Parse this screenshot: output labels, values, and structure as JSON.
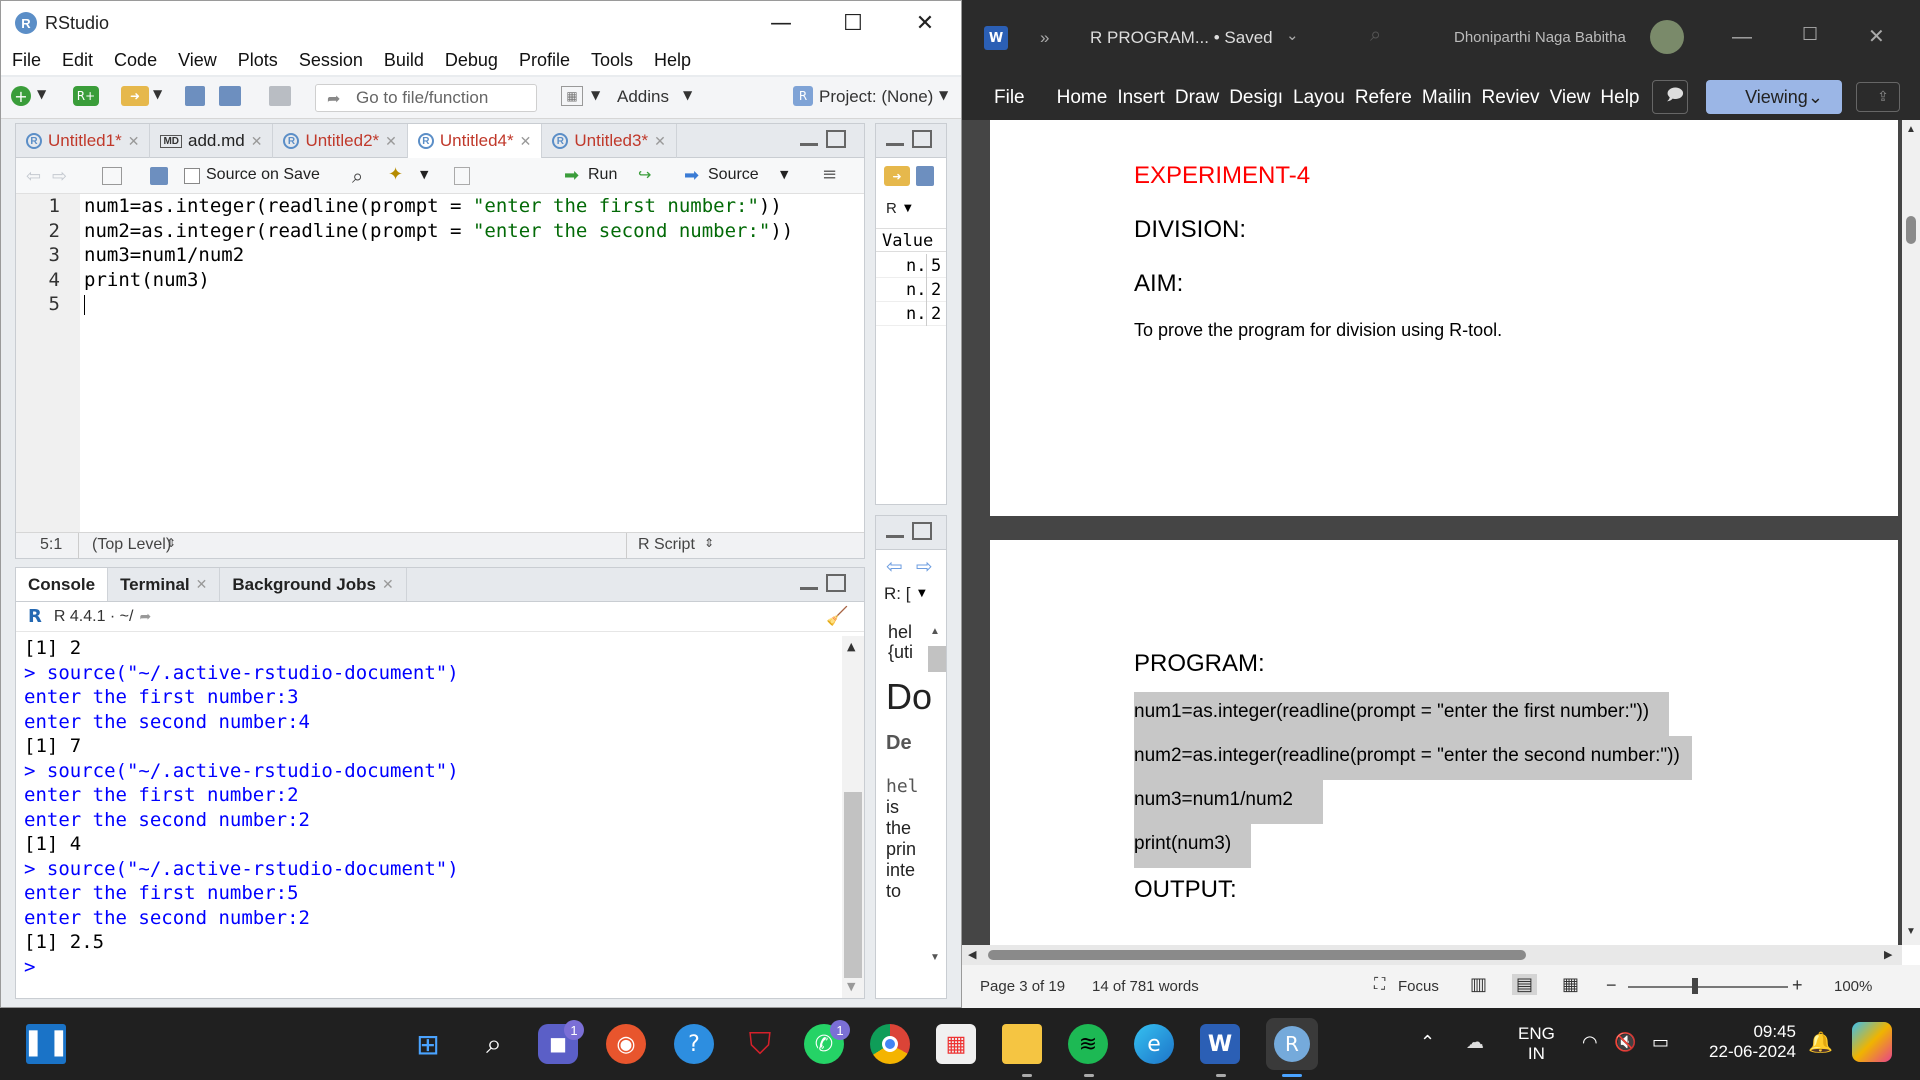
{
  "rstudio": {
    "title": "RStudio",
    "menu": [
      "File",
      "Edit",
      "Code",
      "View",
      "Plots",
      "Session",
      "Build",
      "Debug",
      "Profile",
      "Tools",
      "Help"
    ],
    "toolbar": {
      "goto_placeholder": "Go to file/function",
      "addins": "Addins",
      "project": "Project: (None)"
    },
    "editor": {
      "tabs": [
        {
          "label": "Untitled1*",
          "type": "r"
        },
        {
          "label": "add.md",
          "type": "md"
        },
        {
          "label": "Untitled2*",
          "type": "r"
        },
        {
          "label": "Untitled4*",
          "type": "r",
          "active": true
        },
        {
          "label": "Untitled3*",
          "type": "r"
        }
      ],
      "source_on_save": "Source on Save",
      "run": "Run",
      "source": "Source",
      "line_numbers": [
        "1",
        "2",
        "3",
        "4",
        "5"
      ],
      "lines": [
        {
          "pre": "num1=as.integer(readline(prompt = ",
          "str": "\"enter the first number:\"",
          "post": "))"
        },
        {
          "pre": "num2=as.integer(readline(prompt = ",
          "str": "\"enter the second number:\"",
          "post": "))"
        },
        {
          "pre": "num3=num1/num2",
          "str": "",
          "post": ""
        },
        {
          "pre": "print(num3)",
          "str": "",
          "post": ""
        },
        {
          "pre": "",
          "str": "",
          "post": ""
        }
      ],
      "status": {
        "position": "5:1",
        "scope": "(Top Level)",
        "type": "R Script"
      }
    },
    "console": {
      "tabs": [
        "Console",
        "Terminal",
        "Background Jobs"
      ],
      "version": "R 4.4.1 · ~/",
      "lines": [
        {
          "t": "[1] 2",
          "k": "out"
        },
        {
          "t": "> source(\"~/.active-rstudio-document\")",
          "k": "cmd"
        },
        {
          "t": "enter the first number:3",
          "k": "cmd"
        },
        {
          "t": "enter the second number:4",
          "k": "cmd"
        },
        {
          "t": "[1] 7",
          "k": "out"
        },
        {
          "t": "> source(\"~/.active-rstudio-document\")",
          "k": "cmd"
        },
        {
          "t": "enter the first number:2",
          "k": "cmd"
        },
        {
          "t": "enter the second number:2",
          "k": "cmd"
        },
        {
          "t": "[1] 4",
          "k": "out"
        },
        {
          "t": "> source(\"~/.active-rstudio-document\")",
          "k": "cmd"
        },
        {
          "t": "enter the first number:5",
          "k": "cmd"
        },
        {
          "t": "enter the second number:2",
          "k": "cmd"
        },
        {
          "t": "[1] 2.5",
          "k": "out"
        },
        {
          "t": ">",
          "k": "cmd"
        }
      ]
    },
    "env": {
      "lang": "R",
      "header": "Value",
      "rows": [
        {
          "n": "n.",
          "v": "5"
        },
        {
          "n": "n.",
          "v": "2"
        },
        {
          "n": "n.",
          "v": "2"
        }
      ]
    },
    "help": {
      "nav": "R: [",
      "lines": [
        "hel",
        "{uti"
      ],
      "title": "Do",
      "desc": "De",
      "body": [
        "hel",
        "is",
        "the",
        "prin",
        "inte",
        "to"
      ]
    }
  },
  "word": {
    "doc_title": "R PROGRAM... • Saved",
    "user": "Dhoniparthi Naga Babitha",
    "ribbon": [
      "File",
      "Home",
      "Insert",
      "Draw",
      "Desigı",
      "Layou",
      "Refere",
      "Mailin",
      "Reviev",
      "View",
      "Help"
    ],
    "viewing": "Viewing",
    "page1": {
      "experiment": "EXPERIMENT-4",
      "division": "DIVISION:",
      "aim": "AIM:",
      "aim_text": "To prove the program for division using R-tool."
    },
    "page2": {
      "program": "PROGRAM:",
      "code": [
        "num1=as.integer(readline(prompt = \"enter the first number:\"))",
        "num2=as.integer(readline(prompt = \"enter the second number:\"))",
        "num3=num1/num2",
        "print(num3)"
      ],
      "output": "OUTPUT:"
    },
    "status": {
      "page": "Page 3 of 19",
      "words": "14 of 781 words",
      "focus": "Focus",
      "zoom": "100%"
    },
    "colors": {
      "experiment": "#ff0000",
      "highlight": "#c7c7c7"
    }
  },
  "taskbar": {
    "lang": "ENG",
    "region": "IN",
    "time": "09:45",
    "date": "22-06-2024",
    "badges": {
      "teams": "1",
      "whatsapp": "1"
    },
    "icons": [
      "start-icon",
      "search-icon",
      "teams-icon",
      "firefox-icon",
      "help-icon",
      "mcafee-icon",
      "whatsapp-icon",
      "chrome-icon",
      "store-icon",
      "explorer-icon",
      "spotify-icon",
      "edge-icon",
      "word-icon",
      "rstudio-icon"
    ]
  }
}
